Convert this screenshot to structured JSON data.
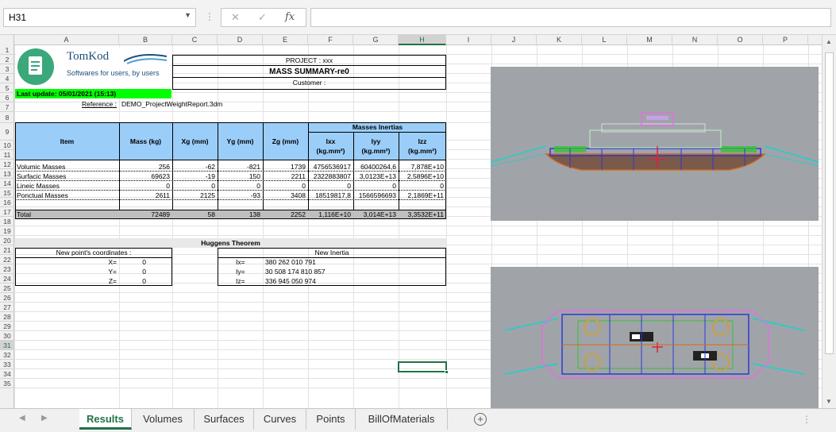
{
  "formula_bar": {
    "cell_ref": "H31",
    "fx": "fx",
    "cancel": "✕",
    "confirm": "✓",
    "formula": ""
  },
  "columns": [
    "A",
    "B",
    "C",
    "D",
    "E",
    "F",
    "G",
    "H",
    "I",
    "J",
    "K",
    "L",
    "M",
    "N",
    "O",
    "P"
  ],
  "rows": [
    "1",
    "2",
    "3",
    "4",
    "5",
    "6",
    "7",
    "8",
    "9",
    "10",
    "11",
    "12",
    "13",
    "14",
    "15",
    "16",
    "17",
    "18",
    "19",
    "20",
    "21",
    "22",
    "23",
    "24",
    "25",
    "26",
    "27",
    "28",
    "29",
    "30",
    "31",
    "32",
    "33",
    "34",
    "35"
  ],
  "logo": {
    "brand": "TomKod",
    "tagline": "Softwares for users, by users"
  },
  "project": {
    "project_line": "PROJECT : xxx",
    "title": "MASS SUMMARY-re0",
    "customer": "Customer :"
  },
  "last_update": "Last update:  05/01/2021 (15:13)",
  "reference": {
    "label": "Reference :",
    "value": "DEMO_ProjectWeightReport.3dm"
  },
  "table": {
    "header": {
      "item": "Item",
      "mass": "Mass (kg)",
      "xg": "Xg (mm)",
      "yg": "Yg (mm)",
      "zg": "Zg (mm)",
      "inertias": "Masses Inertias",
      "ixx": "Ixx",
      "iyy": "Iyy",
      "izz": "Izz",
      "unit": "(kg.mm²)"
    },
    "rows": [
      {
        "item": "Volumic Masses",
        "mass": "256",
        "xg": "-62",
        "yg": "-821",
        "zg": "1739",
        "ixx": "4756536917",
        "iyy": "60400264,6",
        "izz": "7,878E+10"
      },
      {
        "item": "Surfacic Masses",
        "mass": "69623",
        "xg": "-19",
        "yg": "150",
        "zg": "2211",
        "ixx": "2322883807",
        "iyy": "3,0123E+13",
        "izz": "2,5896E+10"
      },
      {
        "item": "Lineic Masses",
        "mass": "0",
        "xg": "0",
        "yg": "0",
        "zg": "0",
        "ixx": "0",
        "iyy": "0",
        "izz": "0"
      },
      {
        "item": "Ponctual Masses",
        "mass": "2611",
        "xg": "2125",
        "yg": "-93",
        "zg": "3408",
        "ixx": "18519817,8",
        "iyy": "1566596693",
        "izz": "2,1869E+11"
      }
    ],
    "total": {
      "item": "Total",
      "mass": "72489",
      "xg": "58",
      "yg": "138",
      "zg": "2252",
      "ixx": "1,116E+10",
      "iyy": "3,014E+13",
      "izz": "3,3532E+11"
    }
  },
  "huygens": {
    "title": "Huggens Theorem",
    "new_point": "New point's coordinates :",
    "x_label": "X=",
    "y_label": "Y=",
    "z_label": "Z=",
    "x": "0",
    "y": "0",
    "z": "0",
    "new_inertia": "New Inertia",
    "ix_label": "Ix=",
    "iy_label": "Iy=",
    "iz_label": "Iz=",
    "ix": "380 262 010 791",
    "iy": "30 508 174 810 857",
    "iz": "336 945 050 974"
  },
  "tabs": [
    "Results",
    "Volumes",
    "Surfaces",
    "Curves",
    "Points",
    "BillOfMaterials"
  ],
  "active_tab": "Results",
  "colors": {
    "header_blue": "#9bcdf9",
    "update_green": "#00ff00",
    "total_gray": "#bfbfbf",
    "viewport_gray": "#a0a4a8",
    "excel_green": "#217346"
  }
}
